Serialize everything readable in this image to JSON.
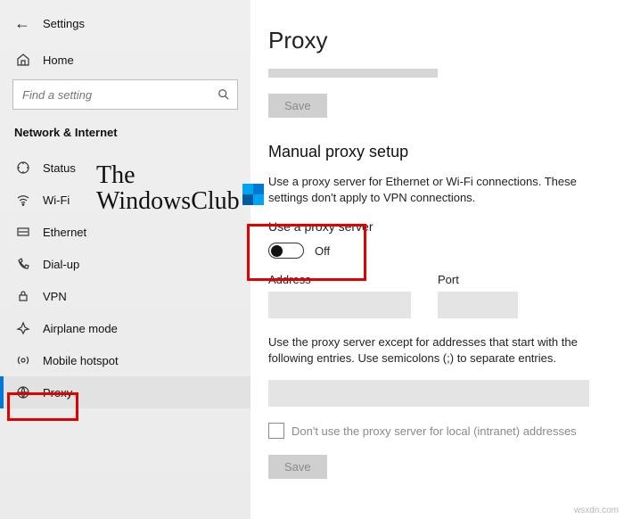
{
  "sidebar": {
    "back_aria": "Back",
    "title": "Settings",
    "home": "Home",
    "search_placeholder": "Find a setting",
    "section": "Network & Internet",
    "items": [
      {
        "label": "Status"
      },
      {
        "label": "Wi-Fi"
      },
      {
        "label": "Ethernet"
      },
      {
        "label": "Dial-up"
      },
      {
        "label": "VPN"
      },
      {
        "label": "Airplane mode"
      },
      {
        "label": "Mobile hotspot"
      },
      {
        "label": "Proxy"
      }
    ]
  },
  "main": {
    "title": "Proxy",
    "save": "Save",
    "section_title": "Manual proxy setup",
    "desc": "Use a proxy server for Ethernet or Wi-Fi connections. These settings don't apply to VPN connections.",
    "use_proxy_label": "Use a proxy server",
    "toggle_state": "Off",
    "address_label": "Address",
    "port_label": "Port",
    "except_desc": "Use the proxy server except for addresses that start with the following entries. Use semicolons (;) to separate entries.",
    "local_label": "Don't use the proxy server for local (intranet) addresses",
    "save2": "Save"
  },
  "watermark": {
    "line1": "The",
    "line2": "WindowsClub"
  },
  "footer": "wsxdn.com"
}
